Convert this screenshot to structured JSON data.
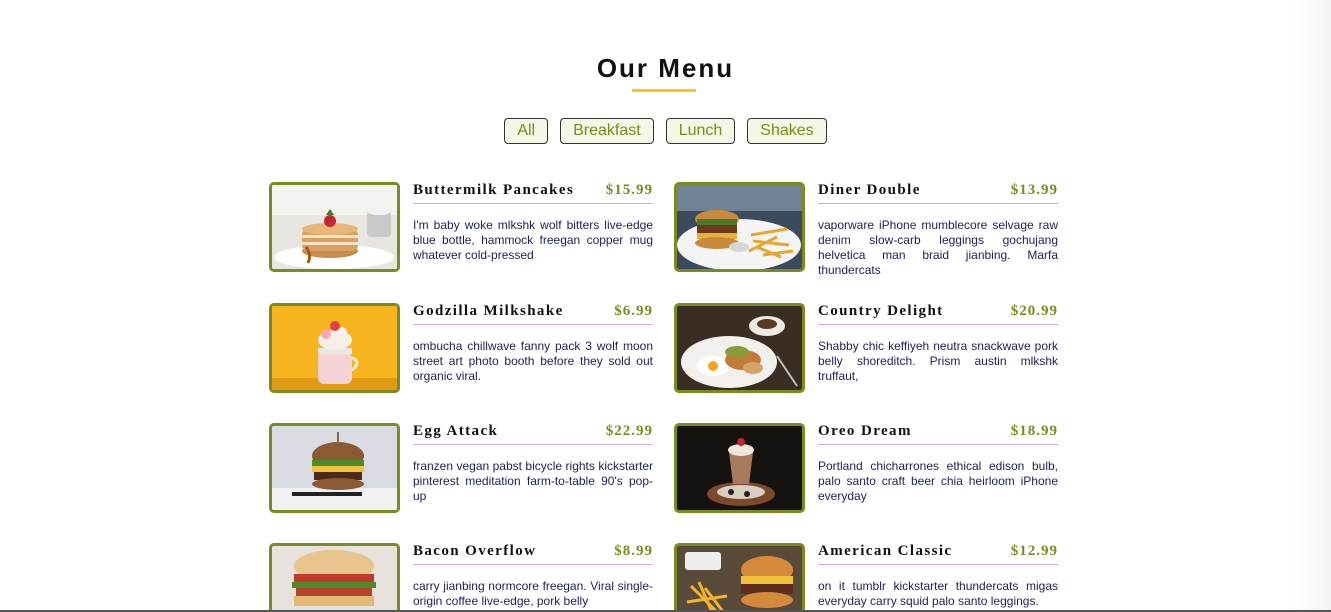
{
  "header": {
    "title": "Our Menu"
  },
  "filters": [
    {
      "label": "All"
    },
    {
      "label": "Breakfast"
    },
    {
      "label": "Lunch"
    },
    {
      "label": "Shakes"
    }
  ],
  "colors": {
    "accent": "#7a8c1f",
    "underline": "#f5c518",
    "divider": "#d8a9d8",
    "description": "#1e1e5a"
  },
  "items": [
    {
      "name": "Buttermilk Pancakes",
      "price": "$15.99",
      "desc": "I'm baby woke mlkshk wolf bitters live-edge blue bottle, hammock freegan copper mug whatever cold-pressed",
      "image": "pancakes-photo"
    },
    {
      "name": "Diner Double",
      "price": "$13.99",
      "desc": "vaporware iPhone mumblecore selvage raw denim slow-carb leggings gochujang helvetica man braid jianbing. Marfa thundercats",
      "image": "burger-fries-photo"
    },
    {
      "name": "Godzilla Milkshake",
      "price": "$6.99",
      "desc": "ombucha chillwave fanny pack 3 wolf moon street art photo booth before they sold out organic viral.",
      "image": "milkshake-photo"
    },
    {
      "name": "Country Delight",
      "price": "$20.99",
      "desc": "Shabby chic keffiyeh neutra snackwave pork belly shoreditch. Prism austin mlkshk truffaut,",
      "image": "breakfast-plate-photo"
    },
    {
      "name": "Egg Attack",
      "price": "$22.99",
      "desc": "franzen vegan pabst bicycle rights kickstarter pinterest meditation farm-to-table 90's pop-up",
      "image": "egg-burger-photo"
    },
    {
      "name": "Oreo Dream",
      "price": "$18.99",
      "desc": "Portland chicharrones ethical edison bulb, palo santo craft beer chia heirloom iPhone everyday",
      "image": "oreo-shake-photo"
    },
    {
      "name": "Bacon Overflow",
      "price": "$8.99",
      "desc": "carry jianbing normcore freegan. Viral single-origin coffee live-edge, pork belly",
      "image": "bacon-sandwich-photo"
    },
    {
      "name": "American Classic",
      "price": "$12.99",
      "desc": "on it tumblr kickstarter thundercats migas everyday carry squid palo santo leggings.",
      "image": "classic-burger-photo"
    }
  ]
}
